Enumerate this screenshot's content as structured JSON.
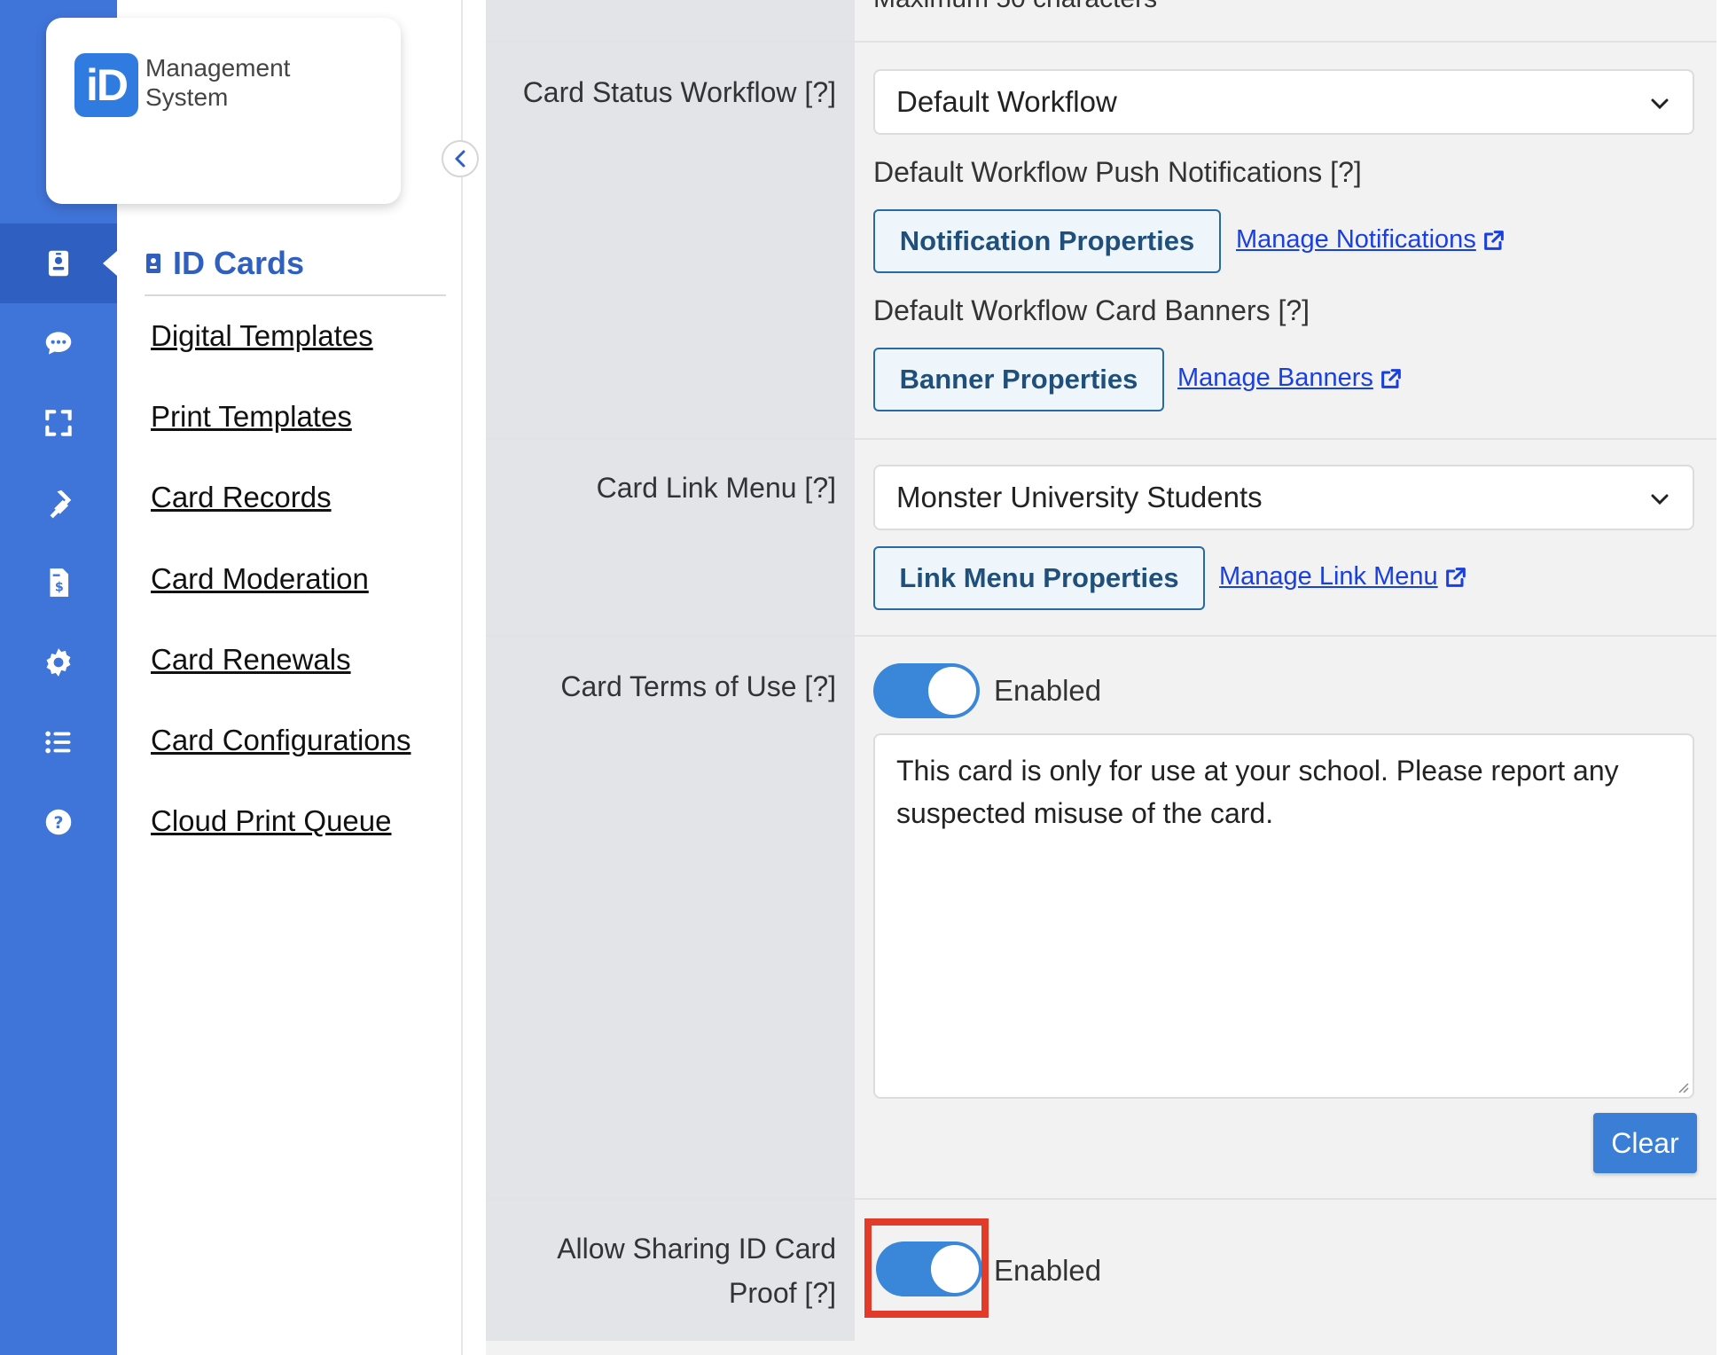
{
  "app": {
    "logo_badge": "iD",
    "logo_line1": "Management",
    "logo_line2": "System"
  },
  "rail": {
    "items": [
      {
        "icon": "id-badge-icon",
        "active": true
      },
      {
        "icon": "chat-bubble-icon"
      },
      {
        "icon": "scan-frame-icon"
      },
      {
        "icon": "plug-icon"
      },
      {
        "icon": "invoice-dollar-icon"
      },
      {
        "icon": "gear-icon"
      },
      {
        "icon": "list-icon"
      },
      {
        "icon": "help-circle-icon"
      }
    ]
  },
  "sidebar": {
    "section_title": "ID Cards",
    "links": [
      "Digital Templates",
      "Print Templates",
      "Card Records",
      "Card Moderation",
      "Card Renewals",
      "Card Configurations",
      "Cloud Print Queue"
    ]
  },
  "form": {
    "top_hint": "Maximum 50 characters",
    "workflow": {
      "label": "Card Status Workflow [?]",
      "selected": "Default Workflow",
      "push_heading": "Default Workflow Push Notifications [?]",
      "notification_button": "Notification Properties",
      "manage_notifications": "Manage Notifications",
      "banners_heading": "Default Workflow Card Banners [?]",
      "banner_button": "Banner Properties",
      "manage_banners": "Manage Banners"
    },
    "link_menu": {
      "label": "Card Link Menu [?]",
      "selected": "Monster University Students",
      "properties_button": "Link Menu Properties",
      "manage_link": "Manage Link Menu"
    },
    "terms": {
      "label": "Card Terms of Use [?]",
      "toggle_label": "Enabled",
      "enabled": true,
      "text": "This card is only for use at your school. Please report any suspected misuse of the card.",
      "clear_button": "Clear"
    },
    "sharing": {
      "label_line1": "Allow Sharing ID Card",
      "label_line2": "Proof [?]",
      "toggle_label": "Enabled",
      "enabled": true
    }
  },
  "colors": {
    "rail": "#3f74d8",
    "accent": "#2f5fc0",
    "toggle_on": "#3a86d8",
    "highlight": "#e33b2a"
  }
}
